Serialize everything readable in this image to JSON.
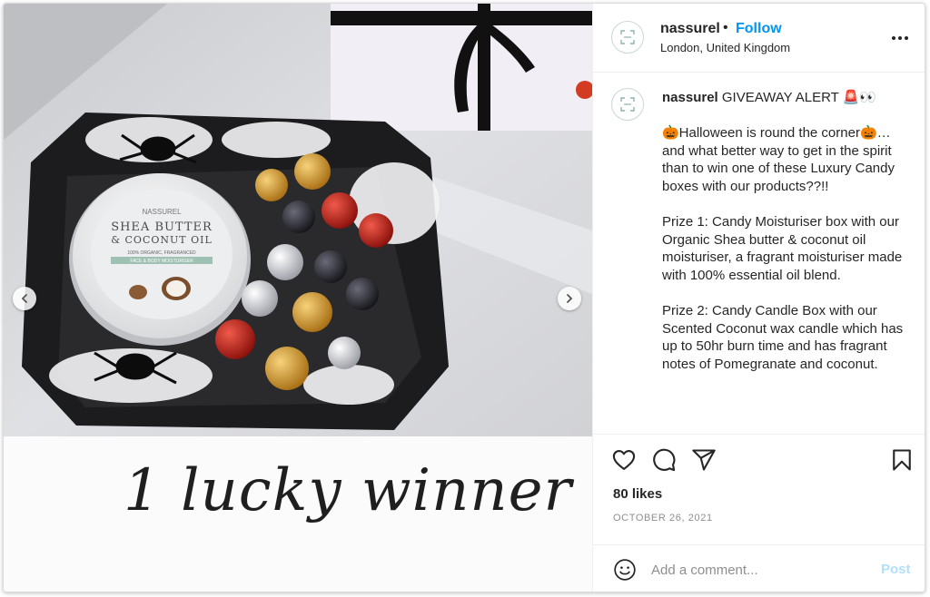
{
  "post": {
    "username": "nassurel",
    "separator": "•",
    "follow_label": "Follow",
    "location": "London, United Kingdom",
    "caption_username": "nassurel",
    "caption_text": " GIVEAWAY ALERT 🚨👀\n\n🎃Halloween is round the corner🎃… and what better way to get in the spirit than to win one of these Luxury Candy boxes with our products??!!\n\nPrize 1: Candy Moisturiser box with our Organic Shea butter & coconut oil moisturiser, a fragrant moisturiser made with 100% essential oil blend.\n\nPrize 2: Candy Candle Box with our Scented Coconut wax candle which has up to 50hr burn time and has fragrant notes of Pomegranate and coconut.",
    "likes": "80 likes",
    "date": "OCTOBER 26, 2021"
  },
  "media": {
    "jar_brand": "NASSUREL",
    "jar_title_1": "SHEA BUTTER",
    "jar_title_2": "& COCONUT OIL",
    "jar_subtitle": "100% ORGANIC, FRAGRANCED",
    "jar_band": "FACE & BODY MOISTURISER",
    "overlay_text": "1 lucky winner"
  },
  "comment": {
    "placeholder": "Add a comment...",
    "post_label": "Post"
  },
  "icons": {
    "avatar": "nassurel-logo-icon",
    "more": "more-options-icon",
    "like": "heart-icon",
    "comment": "comment-icon",
    "share": "share-icon",
    "save": "bookmark-icon",
    "emoji": "emoji-icon",
    "prev": "chevron-left-icon",
    "next": "chevron-right-icon"
  },
  "colors": {
    "accent": "#0095f6",
    "post_disabled": "#b2dffc",
    "muted": "#8e8e8e",
    "text": "#262626"
  }
}
